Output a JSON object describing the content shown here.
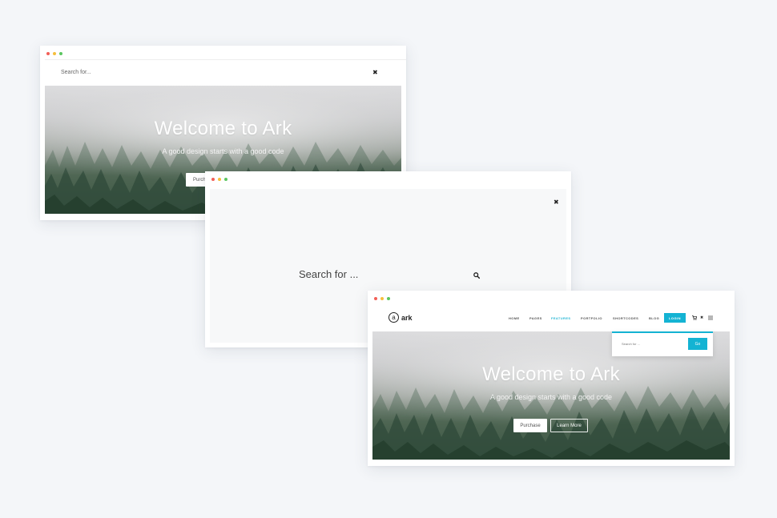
{
  "window1": {
    "search_placeholder": "Search for...",
    "close_glyph": "✖",
    "hero_title": "Welcome to Ark",
    "hero_subtitle": "A good design starts with a good code",
    "purchase_label": "Purchase"
  },
  "window2": {
    "search_placeholder": "Search for ...",
    "close_glyph": "✖",
    "search_icon": "search-icon"
  },
  "window3": {
    "logo_letter": "a",
    "logo_text": "ark",
    "nav": {
      "items": [
        {
          "label": "HOME",
          "active": false
        },
        {
          "label": "PAGES",
          "active": false
        },
        {
          "label": "FEATURES",
          "active": true
        },
        {
          "label": "PORTFOLIO",
          "active": false
        },
        {
          "label": "SHORTCODES",
          "active": false
        },
        {
          "label": "BLOG",
          "active": false
        }
      ],
      "login_label": "LOGIN",
      "cart_glyph": "🛒",
      "close_glyph": "✖",
      "menu_glyph": "≡"
    },
    "dropdown": {
      "placeholder": "Search for ...",
      "go_label": "Go"
    },
    "hero_title": "Welcome to Ark",
    "hero_subtitle": "A good design starts with a good code",
    "purchase_label": "Purchase",
    "learn_more_label": "Learn More"
  },
  "colors": {
    "accent": "#14b3d3",
    "background": "#f4f6f9",
    "dot_red": "#f25f57",
    "dot_yellow": "#f5be3c",
    "dot_green": "#5bc660"
  }
}
